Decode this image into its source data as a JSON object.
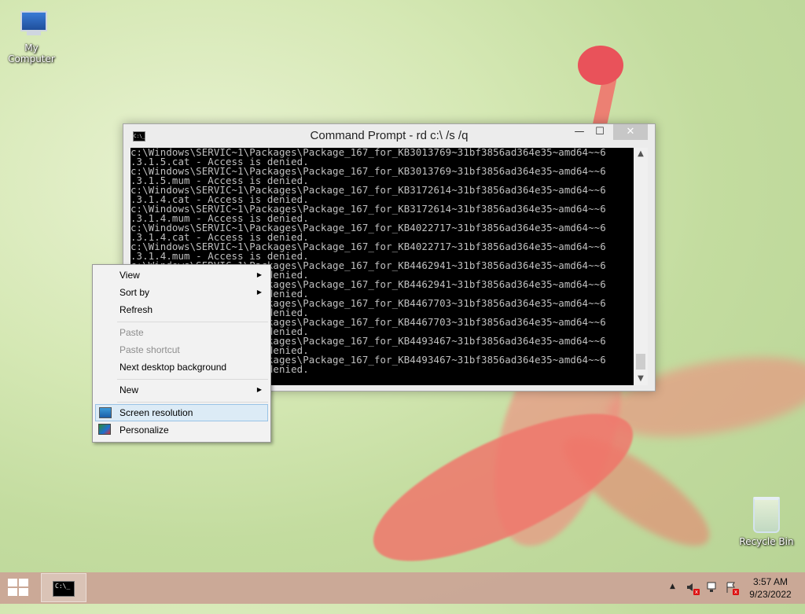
{
  "desktop": {
    "icons": [
      {
        "label": "My Computer",
        "icon": "computer-icon"
      },
      {
        "label": "Recycle Bin",
        "icon": "recycle-bin-icon"
      }
    ]
  },
  "cmd_window": {
    "title": "Command Prompt - rd  c:\\ /s /q",
    "icon": "cmd-icon",
    "icon_text": "C:\\_",
    "lines": [
      "c:\\Windows\\SERVIC~1\\Packages\\Package_167_for_KB3013769~31bf3856ad364e35~amd64~~6",
      ".3.1.5.cat - Access is denied.",
      "c:\\Windows\\SERVIC~1\\Packages\\Package_167_for_KB3013769~31bf3856ad364e35~amd64~~6",
      ".3.1.5.mum - Access is denied.",
      "c:\\Windows\\SERVIC~1\\Packages\\Package_167_for_KB3172614~31bf3856ad364e35~amd64~~6",
      ".3.1.4.cat - Access is denied.",
      "c:\\Windows\\SERVIC~1\\Packages\\Package_167_for_KB3172614~31bf3856ad364e35~amd64~~6",
      ".3.1.4.mum - Access is denied.",
      "c:\\Windows\\SERVIC~1\\Packages\\Package_167_for_KB4022717~31bf3856ad364e35~amd64~~6",
      ".3.1.4.cat - Access is denied.",
      "c:\\Windows\\SERVIC~1\\Packages\\Package_167_for_KB4022717~31bf3856ad364e35~amd64~~6",
      ".3.1.4.mum - Access is denied.",
      "c:\\Windows\\SERVIC~1\\Packages\\Package_167_for_KB4462941~31bf3856ad364e35~amd64~~6",
      ".3.1.4.cat - Access is denied.",
      "c:\\Windows\\SERVIC~1\\Packages\\Package_167_for_KB4462941~31bf3856ad364e35~amd64~~6",
      ".3.1.4.mum - Access is denied.",
      "c:\\Windows\\SERVIC~1\\Packages\\Package_167_for_KB4467703~31bf3856ad364e35~amd64~~6",
      ".3.1.4.cat - Access is denied.",
      "c:\\Windows\\SERVIC~1\\Packages\\Package_167_for_KB4467703~31bf3856ad364e35~amd64~~6",
      ".3.1.4.mum - Access is denied.",
      "c:\\Windows\\SERVIC~1\\Packages\\Package_167_for_KB4493467~31bf3856ad364e35~amd64~~6",
      ".3.1.4.cat - Access is denied.",
      "c:\\Windows\\SERVIC~1\\Packages\\Package_167_for_KB4493467~31bf3856ad364e35~amd64~~6",
      ".3.1.4.mum - Access is denied."
    ],
    "buttons": {
      "minimize": "—",
      "maximize": "☐",
      "close": "✕"
    },
    "scroll_up": "▲",
    "scroll_down": "▼"
  },
  "context_menu": {
    "items": [
      {
        "label": "View",
        "submenu": true,
        "disabled": false
      },
      {
        "label": "Sort by",
        "submenu": true,
        "disabled": false
      },
      {
        "label": "Refresh",
        "submenu": false,
        "disabled": false
      },
      {
        "label": "Paste",
        "submenu": false,
        "disabled": true
      },
      {
        "label": "Paste shortcut",
        "submenu": false,
        "disabled": true
      },
      {
        "label": "Next desktop background",
        "submenu": false,
        "disabled": false
      },
      {
        "label": "New",
        "submenu": true,
        "disabled": false
      },
      {
        "label": "Screen resolution",
        "submenu": false,
        "disabled": false,
        "highlighted": true,
        "icon": "screen-resolution-icon"
      },
      {
        "label": "Personalize",
        "submenu": false,
        "disabled": false,
        "icon": "personalize-icon"
      }
    ],
    "submenu_arrow": "▶"
  },
  "taskbar": {
    "task_icon_text": "C:\\_",
    "tray_arrow": "▲",
    "clock": {
      "time": "3:57 AM",
      "date": "9/23/2022"
    }
  },
  "colors": {
    "console_bg": "#000000",
    "console_text": "#c0c0c0",
    "menu_highlight": "#dcebf6",
    "taskbar": "#cda096"
  }
}
